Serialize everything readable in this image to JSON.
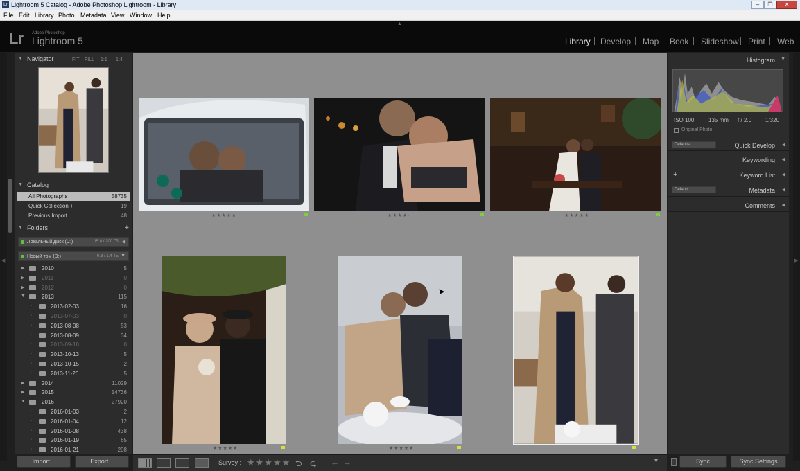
{
  "window": {
    "title": "Lightroom 5 Catalog - Adobe Photoshop Lightroom - Library",
    "icon": "Lr",
    "minimize": "‒",
    "maximize": "❐",
    "close": "✕"
  },
  "menubar": {
    "items": [
      "File",
      "Edit",
      "Library",
      "Photo",
      "Metadata",
      "View",
      "Window",
      "Help"
    ]
  },
  "identity": {
    "logo": "Lr",
    "brand_small": "Adobe Photoshop",
    "brand_name": "Lightroom 5"
  },
  "modules": {
    "items": [
      "Library",
      "Develop",
      "Map",
      "Book",
      "Slideshow",
      "Print",
      "Web"
    ],
    "active": "Library"
  },
  "navigator": {
    "title": "Navigator",
    "zoom": [
      "FIT",
      "FILL",
      "1:1",
      "1:4"
    ]
  },
  "catalog": {
    "title": "Catalog",
    "rows": [
      {
        "label": "All Photographs",
        "count": "58735"
      },
      {
        "label": "Quick Collection +",
        "count": "19"
      },
      {
        "label": "Previous Import",
        "count": "48"
      }
    ]
  },
  "folders": {
    "title": "Folders",
    "add": "+",
    "volumes": [
      {
        "label": "Локальный диск (C:)",
        "space": "15.8 / 200 ГБ"
      },
      {
        "label": "Новый том (D:)",
        "space": "0.8 / 1.4 ТБ"
      }
    ],
    "rows": [
      {
        "label": "2010",
        "count": "5"
      },
      {
        "label": "2011",
        "count": "0"
      },
      {
        "label": "2012",
        "count": "0"
      },
      {
        "label": "2013",
        "count": "115"
      },
      {
        "label": "2013-02-03",
        "count": "16"
      },
      {
        "label": "2013-07-03",
        "count": "0"
      },
      {
        "label": "2013-08-08",
        "count": "53"
      },
      {
        "label": "2013-08-09",
        "count": "34"
      },
      {
        "label": "2013-09-18",
        "count": "0"
      },
      {
        "label": "2013-10-13",
        "count": "5"
      },
      {
        "label": "2013-10-15",
        "count": "2"
      },
      {
        "label": "2013-11-20",
        "count": "5"
      },
      {
        "label": "2014",
        "count": "11029"
      },
      {
        "label": "2015",
        "count": "14736"
      },
      {
        "label": "2016",
        "count": "27920"
      },
      {
        "label": "2016-01-03",
        "count": "2"
      },
      {
        "label": "2016-01-04",
        "count": "12"
      },
      {
        "label": "2016-01-08",
        "count": "438"
      },
      {
        "label": "2016-01-19",
        "count": "65"
      },
      {
        "label": "2016-01-21",
        "count": "208"
      }
    ]
  },
  "left_bottom": {
    "import": "Import...",
    "export": "Export..."
  },
  "toolbar": {
    "survey": "Survey :",
    "stars": "★★★★★",
    "rotate_left": "⮌",
    "rotate_right": "⮎",
    "prev": "←",
    "next": "→",
    "menu": "▾"
  },
  "grid": {
    "photos": [
      {
        "stars": "★★★★★",
        "flag": "#7ecf3a"
      },
      {
        "stars": "★★★★·",
        "flag": "#7ecf3a"
      },
      {
        "stars": "★★★★★",
        "flag": "#7ecf3a"
      },
      {
        "stars": "★★★★★",
        "flag": "#d8e03a"
      },
      {
        "stars": "★★★★★",
        "flag": "#d8e03a"
      },
      {
        "stars": "",
        "flag": "#d8e03a"
      }
    ]
  },
  "histogram": {
    "title": "Histogram",
    "iso": "ISO 100",
    "focal": "135 mm",
    "aperture": "f / 2.0",
    "shutter": "1/320",
    "original": "Original Photo"
  },
  "right_panels": {
    "quick_develop": "Quick Develop",
    "quick_develop_preset": "Defaults",
    "keywording": "Keywording",
    "keyword_list": "Keyword List",
    "metadata": "Metadata",
    "metadata_preset": "Default",
    "comments": "Comments"
  },
  "right_bottom": {
    "sync": "Sync",
    "sync_settings": "Sync Settings"
  },
  "icons": {
    "panel_expand": "triangle-down-icon",
    "panel_collapse": "triangle-left-icon",
    "folder": "folder-icon",
    "grid_view": "grid-view-icon",
    "loupe_view": "loupe-view-icon",
    "compare_view": "compare-view-icon",
    "survey_view": "survey-view-icon"
  }
}
